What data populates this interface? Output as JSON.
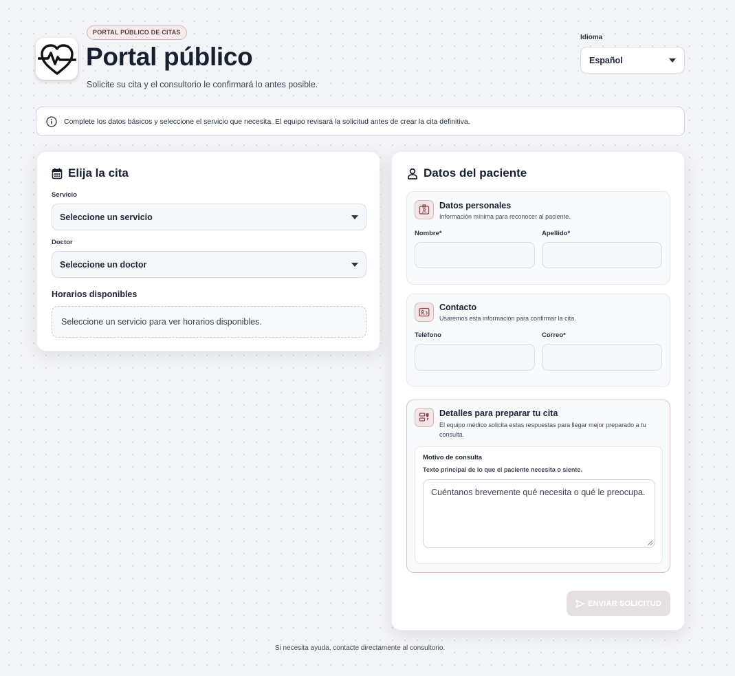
{
  "header": {
    "badge": "PORTAL PÚBLICO DE CITAS",
    "title": "Portal público",
    "subtitle": "Solicite su cita y el consultorio le confirmará lo antes posible.",
    "language_label": "Idioma",
    "language_value": "Español"
  },
  "info_banner": "Complete los datos básicos y seleccione el servicio que necesita. El equipo revisará la solicitud antes de crear la cita definitiva.",
  "appointment": {
    "title": "Elija la cita",
    "service_label": "Servicio",
    "service_value": "Seleccione un servicio",
    "doctor_label": "Doctor",
    "doctor_value": "Seleccione un doctor",
    "slots_title": "Horarios disponibles",
    "slots_empty": "Seleccione un servicio para ver horarios disponibles."
  },
  "patient": {
    "title": "Datos del paciente",
    "personal": {
      "title": "Datos personales",
      "desc": "Información mínima para reconocer al paciente.",
      "first_name_label": "Nombre*",
      "last_name_label": "Apellido*"
    },
    "contact": {
      "title": "Contacto",
      "desc": "Usaremos esta información para confirmar la cita.",
      "phone_label": "Teléfono",
      "email_label": "Correo*"
    },
    "details": {
      "title": "Detalles para preparar tu cita",
      "desc": "El equipo médico solicita estas respuestas para llegar mejor preparado a tu consulta.",
      "reason_label": "Motivo de consulta",
      "reason_hint": "Texto principal de lo que el paciente necesita o siente.",
      "reason_placeholder": "Cuéntanos brevemente qué necesita o qué le preocupa."
    },
    "submit_label": "ENVIAR SOLICITUD"
  },
  "footer": "Si necesita ayuda, contacte directamente al consultorio.",
  "colors": {
    "accent": "#8a4a52",
    "accent_soft": "#f3e6e7",
    "text": "#1c2433",
    "submit_disabled": "#e5dfe1"
  },
  "icons": {
    "logo": "heartbeat-heart-icon",
    "info": "info-circle-icon",
    "calendar": "calendar-icon",
    "person": "person-icon",
    "id_badge": "id-badge-icon",
    "contact_card": "contact-card-icon",
    "details": "details-form-icon",
    "send": "send-icon"
  }
}
